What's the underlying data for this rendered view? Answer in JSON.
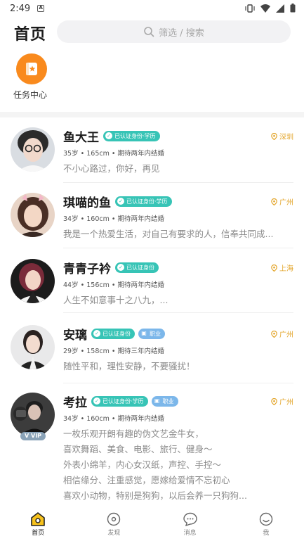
{
  "status_bar": {
    "time": "2:49",
    "notification_letter": "A"
  },
  "header": {
    "title": "首页",
    "search_placeholder": "筛选 / 搜索"
  },
  "task_center": {
    "label": "任务中心"
  },
  "colors": {
    "accent_orange": "#f98a1d",
    "badge_teal": "#37c4b6",
    "badge_blue": "#7cb7ea",
    "location_gold": "#e3a52a"
  },
  "profiles": [
    {
      "name": "鱼大王",
      "badges": [
        "已认证身份·学历"
      ],
      "location": "深圳",
      "meta": "35岁 • 165cm • 期待两年内结婚",
      "bio": [
        "不小心路过，你好，再见"
      ]
    },
    {
      "name": "琪喵的鱼",
      "badges": [
        "已认证身份·学历"
      ],
      "location": "广州",
      "meta": "34岁 • 160cm • 期待两年内结婚",
      "bio": [
        "我是一个热爱生活，对自己有要求的人，信奉共同成..."
      ]
    },
    {
      "name": "青青子衿",
      "badges": [
        "已认证身份"
      ],
      "location": "上海",
      "meta": "44岁 • 156cm • 期待两年内结婚",
      "bio": [
        "人生不如意事十之八九，..."
      ]
    },
    {
      "name": "安璃",
      "badges": [
        "已认证身份"
      ],
      "job_badge": "职业",
      "location": "广州",
      "meta": "29岁 • 158cm • 期待三年内结婚",
      "bio": [
        "随性平和，理性安静，不要骚扰！"
      ]
    },
    {
      "name": "考拉",
      "badges": [
        "已认证身份·学历"
      ],
      "job_badge": "职业",
      "location": "广州",
      "vip": "VIP",
      "meta": "34岁 • 160cm • 期待两年内结婚",
      "bio": [
        "一枚乐观开朗有趣的伪文艺金牛女，",
        "喜欢舞蹈、美食、电影、旅行、健身～",
        "外表小绵羊，内心女汉纸，声控、手控～",
        "相信缘分、注重感觉，愿嫁给爱情不忘初心",
        "喜欢小动物，特别是狗狗，以后会养一只狗狗..."
      ]
    }
  ],
  "bottom_nav": [
    {
      "label": "首页",
      "icon": "home-icon",
      "active": true
    },
    {
      "label": "发现",
      "icon": "discover-icon"
    },
    {
      "label": "消息",
      "icon": "message-icon"
    },
    {
      "label": "我",
      "icon": "profile-icon"
    }
  ]
}
